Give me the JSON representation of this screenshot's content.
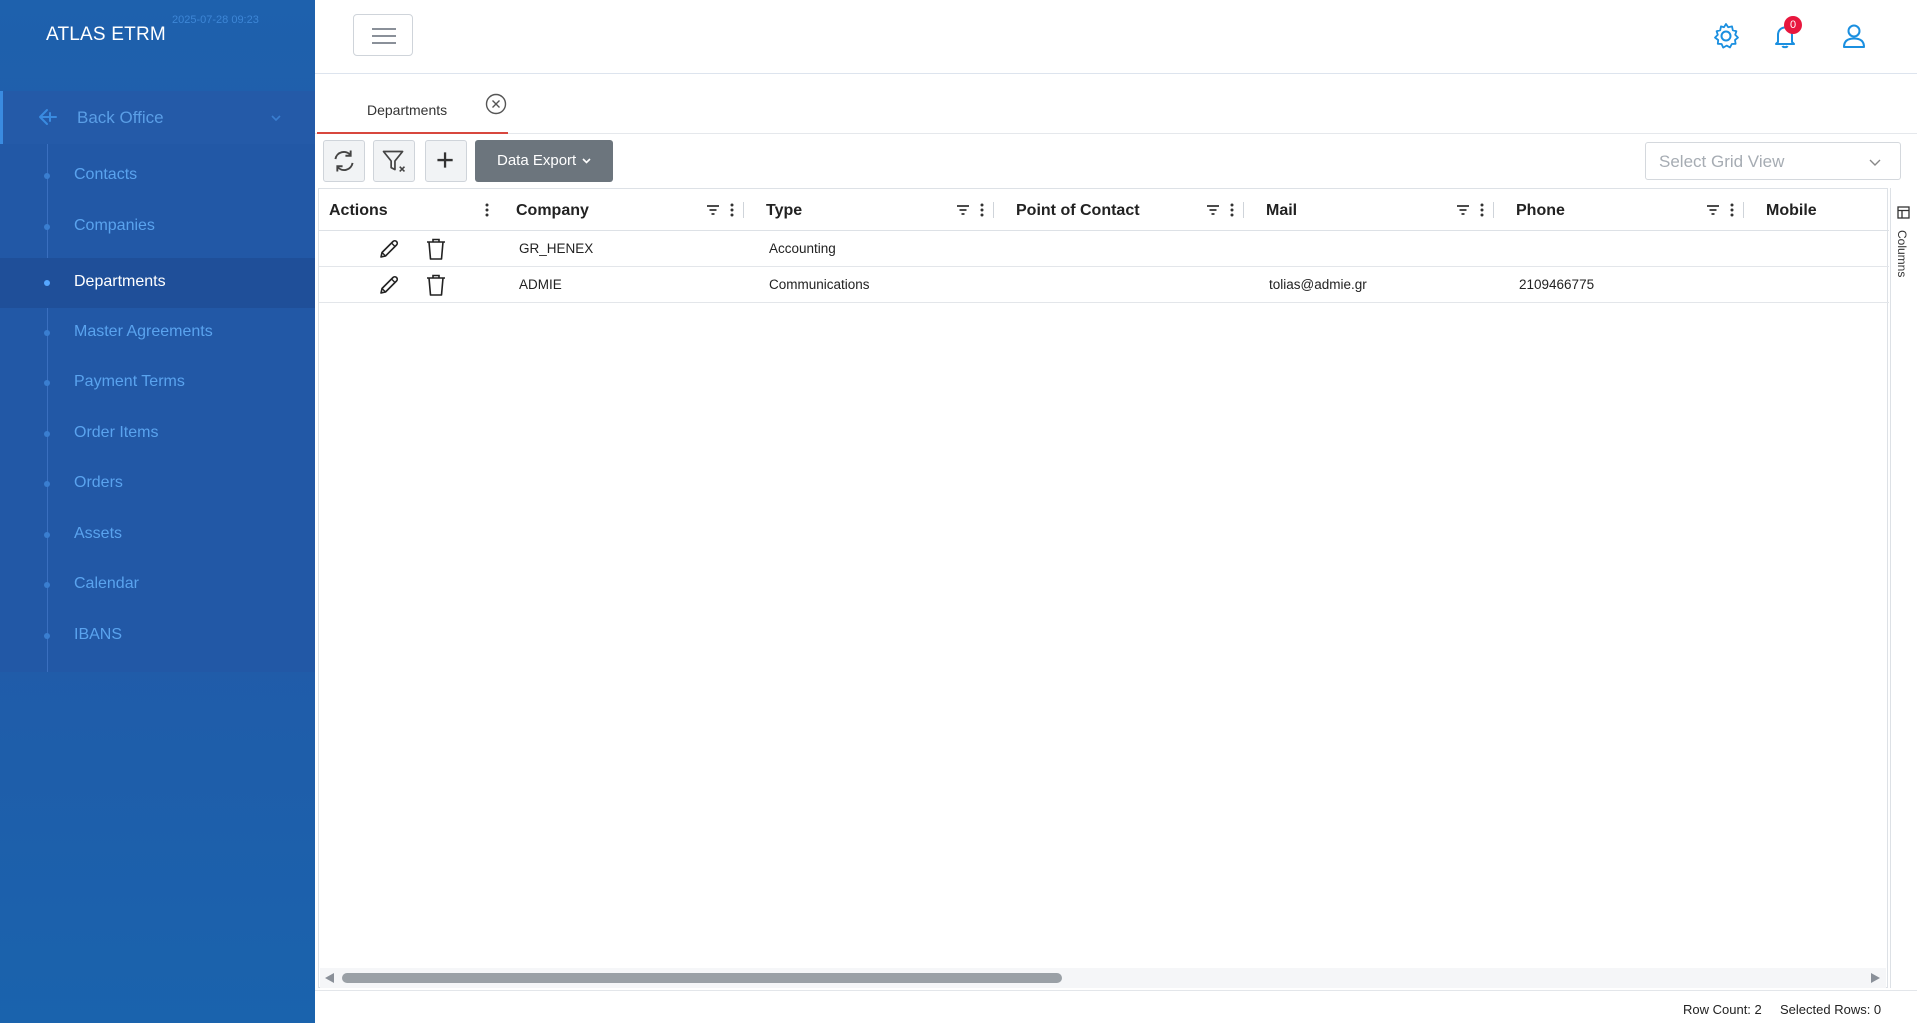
{
  "app": {
    "title": "ATLAS ETRM",
    "timestamp": "2025-07-28 09:23"
  },
  "sidebar": {
    "section_label": "Back Office",
    "items": [
      {
        "label": "Contacts"
      },
      {
        "label": "Companies"
      },
      {
        "label": "Departments",
        "active": true
      },
      {
        "label": "Master Agreements"
      },
      {
        "label": "Payment Terms"
      },
      {
        "label": "Order Items"
      },
      {
        "label": "Orders"
      },
      {
        "label": "Assets"
      },
      {
        "label": "Calendar"
      },
      {
        "label": "IBANS"
      }
    ]
  },
  "topbar": {
    "notification_count": "0",
    "icons": [
      "menu-icon",
      "gear-icon",
      "bell-icon",
      "user-icon"
    ]
  },
  "tabs": [
    {
      "label": "Departments",
      "active": true
    }
  ],
  "toolbar": {
    "export_label": "Data Export",
    "grid_view_placeholder": "Select Grid View",
    "icons": [
      "refresh-icon",
      "clear-filter-icon",
      "plus-icon"
    ]
  },
  "grid": {
    "columns": [
      "Actions",
      "Company",
      "Type",
      "Point of Contact",
      "Mail",
      "Phone",
      "Mobile"
    ],
    "rows": [
      {
        "company": "GR_HENEX",
        "type": "Accounting",
        "point_of_contact": "",
        "mail": "",
        "phone": "",
        "mobile": ""
      },
      {
        "company": "ADMIE",
        "type": "Communications",
        "point_of_contact": "",
        "mail": "tolias@admie.gr",
        "phone": "2109466775",
        "mobile": ""
      }
    ],
    "side_panel_label": "Columns"
  },
  "footer": {
    "row_count": "Row Count: 2",
    "selected_rows": "Selected Rows: 0"
  },
  "colors": {
    "sidebar_bg": "#2258a6",
    "accent_blue": "#1a8fe0",
    "tab_underline": "#d8473e",
    "badge": "#e8173e",
    "export_button": "#6c757d"
  }
}
